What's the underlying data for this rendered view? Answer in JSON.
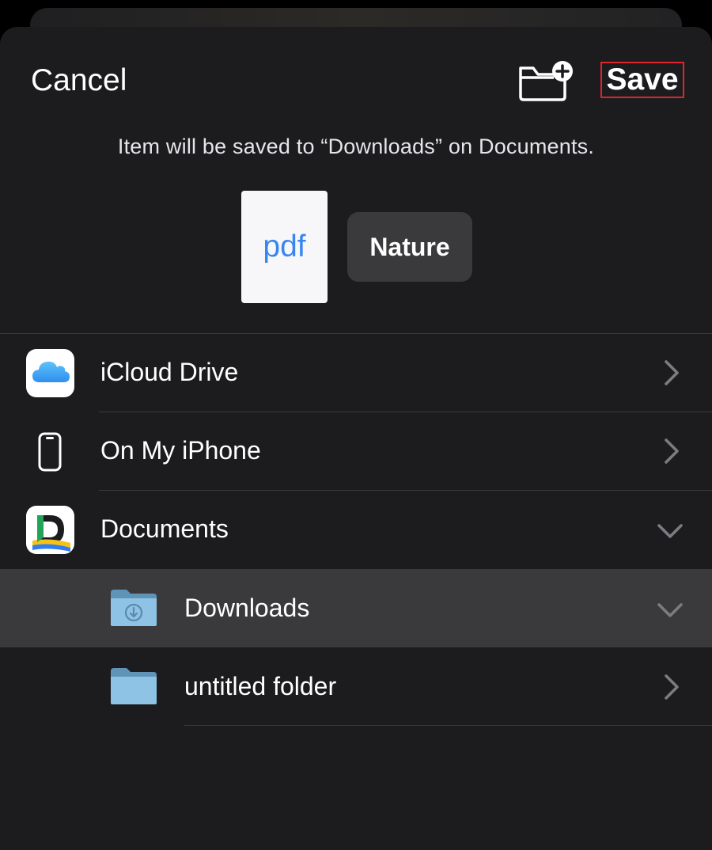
{
  "header": {
    "cancel_label": "Cancel",
    "new_folder_icon": "folder-plus-icon",
    "save_label": "Save"
  },
  "subtitle": "Item will be saved to “Downloads” on Documents.",
  "file": {
    "thumbnail_label": "pdf",
    "name": "Nature"
  },
  "locations": [
    {
      "label": "iCloud Drive",
      "icon": "icloud-icon",
      "accessory": "chevron-right-icon"
    },
    {
      "label": "On My iPhone",
      "icon": "iphone-icon",
      "accessory": "chevron-right-icon"
    },
    {
      "label": "Documents",
      "icon": "documents-app-icon",
      "accessory": "chevron-down-icon"
    }
  ],
  "folders": [
    {
      "label": "Downloads",
      "icon": "downloads-folder-icon",
      "accessory": "chevron-down-icon",
      "selected": true
    },
    {
      "label": "untitled folder",
      "icon": "folder-icon",
      "accessory": "chevron-right-icon",
      "selected": false
    }
  ],
  "colors": {
    "sheet_background": "#1c1c1e",
    "selected_row": "#3a3a3c",
    "highlight_border": "#e0242c",
    "folder_blue": "#8fc3e6",
    "pdf_text": "#3a86f0"
  }
}
